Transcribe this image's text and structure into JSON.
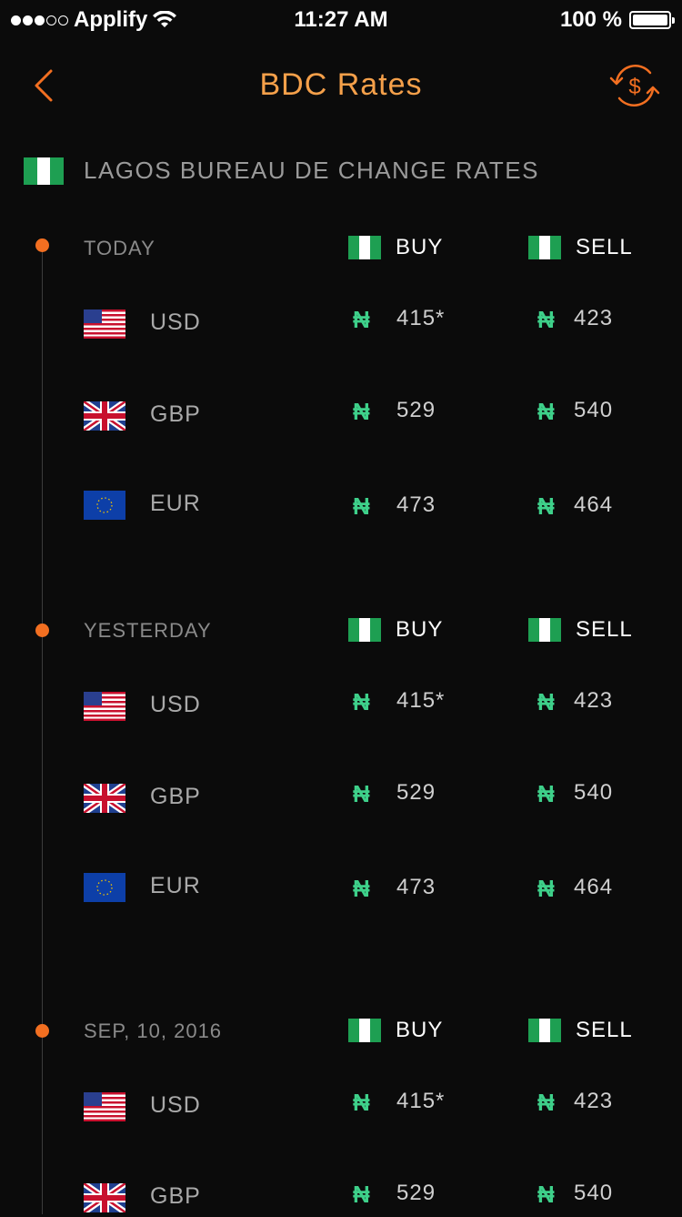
{
  "status_bar": {
    "carrier": "Applify",
    "time": "11:27 AM",
    "battery": "100 %"
  },
  "nav": {
    "title": "BDC Rates",
    "back_icon": "chevron-left-icon",
    "action_icon": "currency-exchange-icon"
  },
  "section": {
    "label": "LAGOS BUREAU DE CHANGE RATES",
    "flag_icon": "nigeria-flag-icon"
  },
  "columns": {
    "buy": "BUY",
    "sell": "SELL"
  },
  "currency_symbol": "₦",
  "groups": [
    {
      "label": "TODAY",
      "rows": [
        {
          "code": "USD",
          "flag": "us-flag-icon",
          "buy": "415*",
          "sell": "423"
        },
        {
          "code": "GBP",
          "flag": "uk-flag-icon",
          "buy": "529",
          "sell": "540"
        },
        {
          "code": "EUR",
          "flag": "eu-flag-icon",
          "buy": "473",
          "sell": "464"
        }
      ]
    },
    {
      "label": "YESTERDAY",
      "rows": [
        {
          "code": "USD",
          "flag": "us-flag-icon",
          "buy": "415*",
          "sell": "423"
        },
        {
          "code": "GBP",
          "flag": "uk-flag-icon",
          "buy": "529",
          "sell": "540"
        },
        {
          "code": "EUR",
          "flag": "eu-flag-icon",
          "buy": "473",
          "sell": "464"
        }
      ]
    },
    {
      "label": "SEP, 10, 2016",
      "rows": [
        {
          "code": "USD",
          "flag": "us-flag-icon",
          "buy": "415*",
          "sell": "423"
        },
        {
          "code": "GBP",
          "flag": "uk-flag-icon",
          "buy": "529",
          "sell": "540"
        }
      ]
    }
  ],
  "colors": {
    "background": "#0b0b0b",
    "title": "#f5a04a",
    "accent": "#f26f21",
    "naira": "#3ed08a",
    "nigeria_green": "#1e9f52"
  }
}
